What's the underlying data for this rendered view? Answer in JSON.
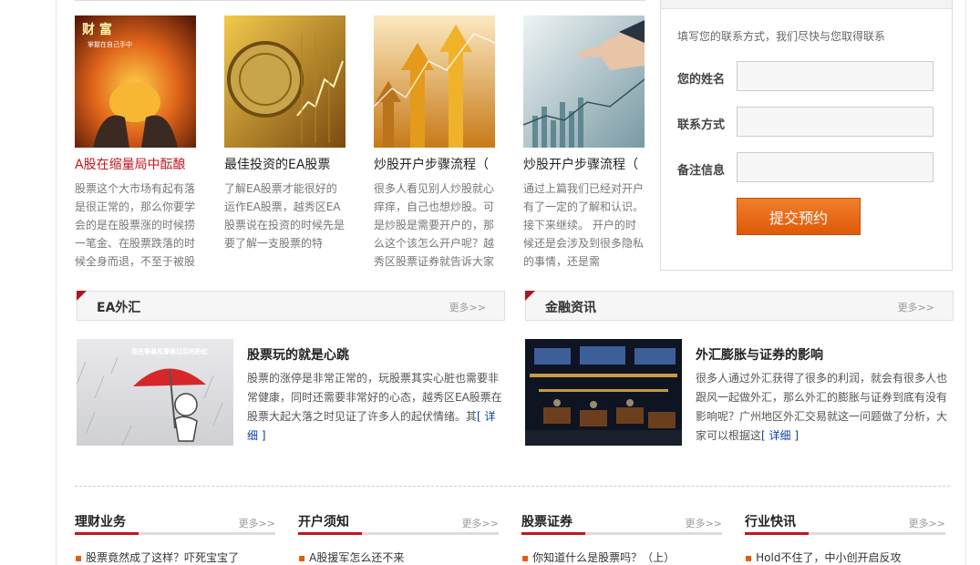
{
  "articles": [
    {
      "title": "A股在缩量局中酝酿",
      "desc": "股票这个大市场有起有落是很正常的，那么你要学会的是在股票涨的时候捞一笔金、在股票跌落的时候全身而退，不至于被股",
      "image": "wealth-hands-image"
    },
    {
      "title": "最佳投资的EA股票",
      "desc": "了解EA股票才能很好的运作EA股票，越秀区EA股票说在投资的时候先是要了解一支股票的特",
      "image": "coin-chart-image"
    },
    {
      "title": "炒股开户步骤流程（",
      "desc": "很多人看见别人炒股就心痒痒，自己也想炒股。可是炒股是需要开户的，那么这个该怎么开户呢？越秀区股票证券就告诉大家",
      "image": "rising-arrows-image"
    },
    {
      "title": "炒股开户步骤流程（",
      "desc": "通过上篇我们已经对开户有了一定的了解和认识。接下来继续。 开户的时候还是会涉及到很多隐私的事情，还是需",
      "image": "touch-chart-image"
    }
  ],
  "form": {
    "intro": "填写您的联系方式，我们尽快与您取得联系",
    "name_label": "您的姓名",
    "contact_label": "联系方式",
    "note_label": "备注信息",
    "submit_label": "提交预约"
  },
  "sections": {
    "forex": {
      "title": "EA外汇",
      "more": "更多>>"
    },
    "finance": {
      "title": "金融资讯",
      "more": "更多>>"
    }
  },
  "features": {
    "forex": {
      "image_caption": "我在等暴风骤雨过后的彩虹",
      "title": "股票玩的就是心跳",
      "desc": "股票的涨停是非常正常的，玩股票其实心脏也需要非常健康，同时还需要非常好的心态，越秀区EA股票在股票大起大落之时见证了许多人的起伏情绪。其",
      "link": "[ 详细 ]"
    },
    "finance": {
      "title": "外汇膨胀与证券的影响",
      "desc": "很多人通过外汇获得了很多的利润，就会有很多人也跟风一起做外汇，那么外汇的膨胀与证券到底有没有影响呢？广州地区外汇交易就这一问题做了分析，大家可以根据这",
      "link": "[ 详细 ]"
    }
  },
  "columns": [
    {
      "title": "理财业务",
      "more": "更多>>",
      "item": "股票竟然成了这样？吓死宝宝了"
    },
    {
      "title": "开户须知",
      "more": "更多>>",
      "item": "A股援军怎么还不来"
    },
    {
      "title": "股票证券",
      "more": "更多>>",
      "item": "你知道什么是股票吗？（上）"
    },
    {
      "title": "行业快讯",
      "more": "更多>>",
      "item": "Hold不住了，中小创开启反攻"
    }
  ],
  "colors": {
    "accent_red": "#c4161c",
    "button_orange": "#e8620f",
    "link_blue": "#0b3fa8"
  }
}
